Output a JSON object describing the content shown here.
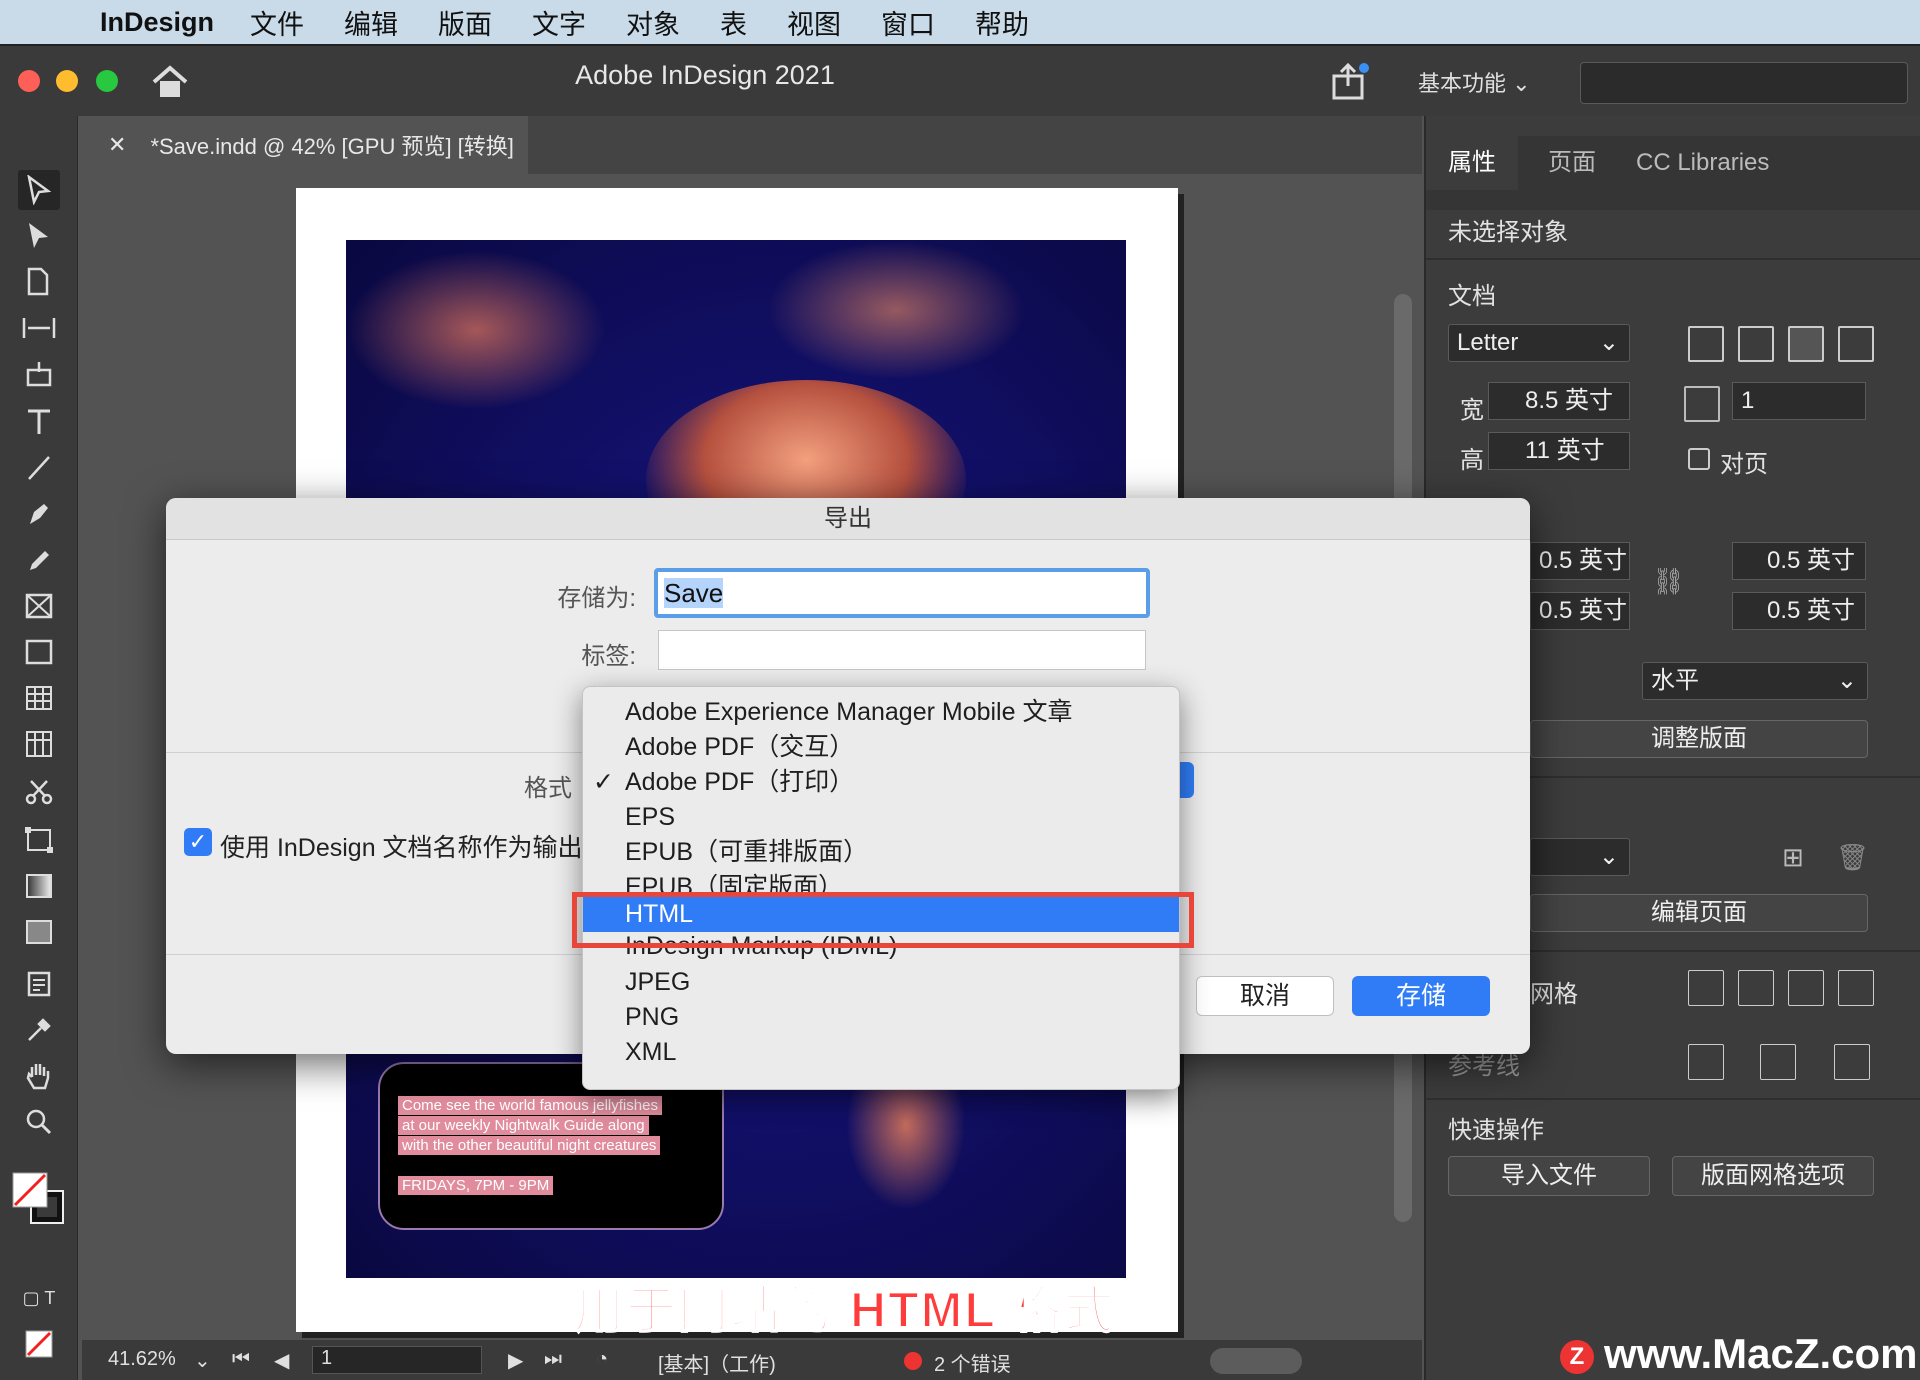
{
  "menubar": {
    "app_name": "InDesign",
    "items": [
      "文件",
      "编辑",
      "版面",
      "文字",
      "对象",
      "表",
      "视图",
      "窗口",
      "帮助"
    ]
  },
  "window": {
    "title": "Adobe InDesign 2021",
    "workspace": "基本功能"
  },
  "document_tab": {
    "title": "*Save.indd @ 42% [GPU 预览] [转换]"
  },
  "canvas": {
    "promo_lines": [
      "Come see the world famous jellyfishes",
      "at our weekly Nightwalk Guide along",
      "with the other beautiful night creatures",
      "FRIDAYS, 7PM - 9PM"
    ],
    "caption": "用于网站的 HTML 格式"
  },
  "statusbar": {
    "zoom": "41.62%",
    "page": "1",
    "profile": "[基本]（工作)",
    "errors": "2 个错误"
  },
  "right_panel": {
    "tabs": [
      "属性",
      "页面",
      "CC Libraries"
    ],
    "no_selection": "未选择对象",
    "document_label": "文档",
    "page_size": "Letter",
    "width_label": "宽",
    "width_value": "8.5 英寸",
    "height_label": "高",
    "height_value": "11 英寸",
    "pages_value": "1",
    "facing_pages": "对页",
    "margin_top": "0.5 英寸",
    "margin_bottom": "0.5 英寸",
    "margin_left": "0.5 英寸",
    "margin_right": "0.5 英寸",
    "orientation": "水平",
    "adjust_layout": "调整版面",
    "edit_page": "编辑页面",
    "grid_label": "网格",
    "guides_label": "参考线",
    "quick_actions": "快速操作",
    "import_file": "导入文件",
    "layout_grid_options": "版面网格选项"
  },
  "dialog": {
    "title": "导出",
    "save_as_label": "存储为:",
    "save_as_value": "Save",
    "tags_label": "标签:",
    "tags_value": "",
    "format_label": "格式",
    "use_doc_name_label": "使用 InDesign 文档名称作为输出",
    "cancel": "取消",
    "save": "存储"
  },
  "format_menu": {
    "items": [
      "Adobe Experience Manager Mobile 文章",
      "Adobe PDF（交互）",
      "Adobe PDF（打印）",
      "EPS",
      "EPUB（可重排版面）",
      "EPUB（固定版面）",
      "HTML",
      "InDesign Markup (IDML)",
      "JPEG",
      "PNG",
      "XML"
    ],
    "checked_index": 2,
    "highlighted_index": 6
  },
  "watermark": "www.MacZ.com",
  "colors": {
    "accent": "#2f7cf6",
    "highlight_frame": "#e8463a",
    "caption": "#ff3c3c"
  }
}
